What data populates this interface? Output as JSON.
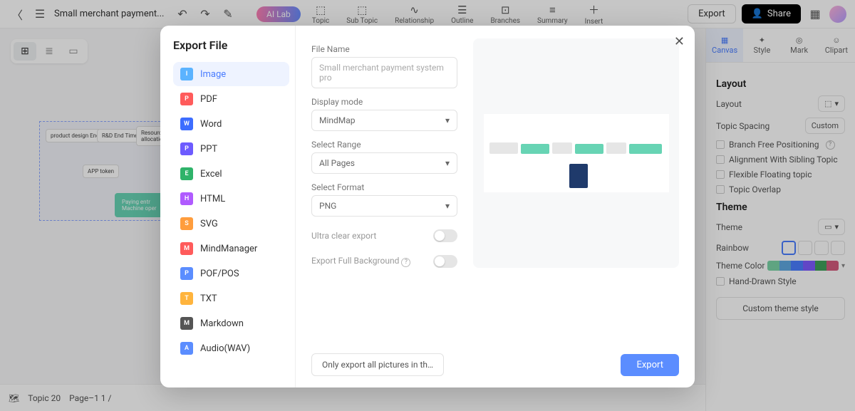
{
  "topbar": {
    "doc_title": "Small merchant payment...",
    "ai_lab": "AI Lab",
    "tools": [
      {
        "label": "Topic"
      },
      {
        "label": "Sub Topic"
      },
      {
        "label": "Relationship"
      },
      {
        "label": "Outline"
      },
      {
        "label": "Branches"
      },
      {
        "label": "Summary"
      },
      {
        "label": "Insert"
      }
    ],
    "export": "Export",
    "share": "Share"
  },
  "right_panel": {
    "tabs": [
      "Canvas",
      "Style",
      "Mark",
      "Clipart"
    ],
    "layout_title": "Layout",
    "layout_label": "Layout",
    "topic_spacing_label": "Topic Spacing",
    "topic_spacing_value": "Custom",
    "branch_free": "Branch Free Positioning",
    "alignment": "Alignment With Sibling Topic",
    "flexible": "Flexible Floating topic",
    "overlap": "Topic Overlap",
    "theme_title": "Theme",
    "theme_label": "Theme",
    "rainbow_label": "Rainbow",
    "theme_color_label": "Theme Color",
    "hand_drawn": "Hand-Drawn Style",
    "custom_theme_btn": "Custom theme style"
  },
  "status": {
    "topic": "Topic 20",
    "page": "Page–1  1 /"
  },
  "mindmap": {
    "n1": "product design End Time",
    "n2": "R&D End Time",
    "n3": "Resource allocation",
    "n4": "APP token",
    "n5": "Paying entr Machine oper"
  },
  "modal": {
    "title": "Export File",
    "formats": [
      {
        "label": "Image",
        "color": "#5bb3ff"
      },
      {
        "label": "PDF",
        "color": "#ff5b5b"
      },
      {
        "label": "Word",
        "color": "#3d6dff"
      },
      {
        "label": "PPT",
        "color": "#6d5bff"
      },
      {
        "label": "Excel",
        "color": "#2fb36a"
      },
      {
        "label": "HTML",
        "color": "#b05bff"
      },
      {
        "label": "SVG",
        "color": "#ff9d3d"
      },
      {
        "label": "MindManager",
        "color": "#ff5b5b"
      },
      {
        "label": "POF/POS",
        "color": "#5b8dff"
      },
      {
        "label": "TXT",
        "color": "#ffb43d"
      },
      {
        "label": "Markdown",
        "color": "#555"
      },
      {
        "label": "Audio(WAV)",
        "color": "#5b8dff"
      }
    ],
    "file_name_label": "File Name",
    "file_name_placeholder": "Small merchant payment system pro",
    "display_mode_label": "Display mode",
    "display_mode_value": "MindMap",
    "range_label": "Select Range",
    "range_value": "All Pages",
    "format_label": "Select Format",
    "format_value": "PNG",
    "ultra_clear": "Ultra clear export",
    "full_bg": "Export Full Background",
    "only_export": "Only export all pictures in th…",
    "export_btn": "Export"
  }
}
